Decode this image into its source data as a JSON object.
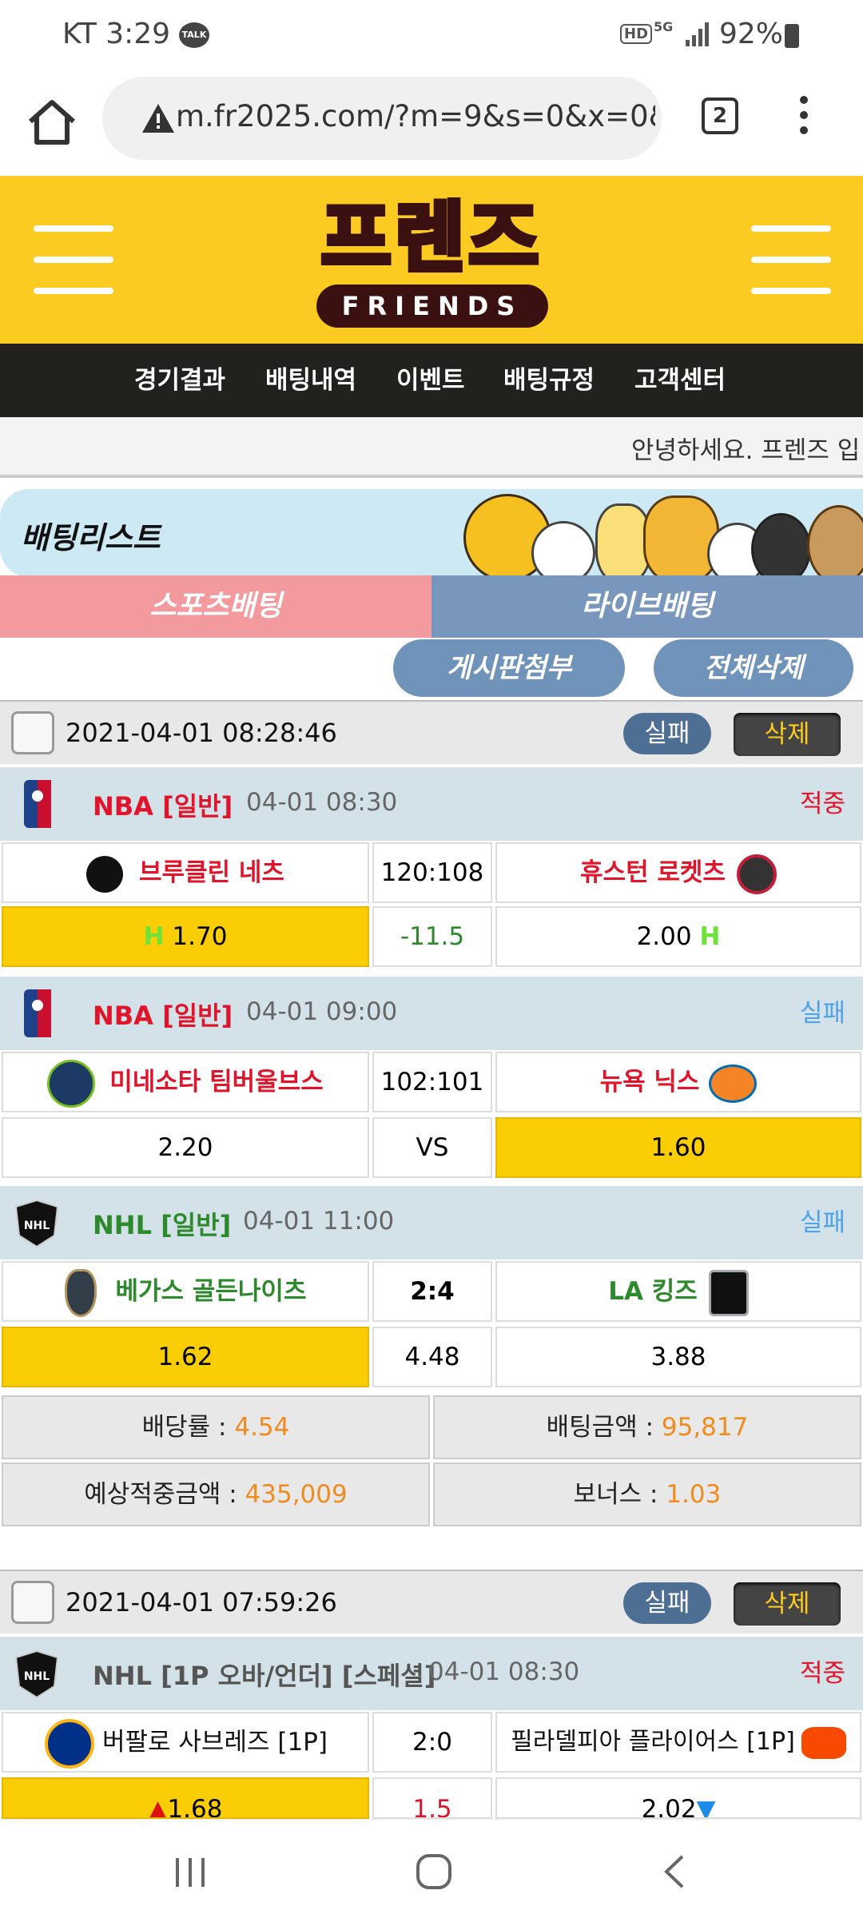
{
  "status_bar": {
    "carrier_time": "KT 3:29",
    "talk": "TALK",
    "hd": "HD",
    "net": "5G",
    "battery": "92%"
  },
  "browser": {
    "url": "m.fr2025.com/?m=9&s=0&x=0&p=",
    "tab_count": "2"
  },
  "logo": {
    "korean": "프렌즈",
    "english": "FRIENDS"
  },
  "nav": [
    "경기결과",
    "배팅내역",
    "이벤트",
    "배팅규정",
    "고객센터"
  ],
  "marquee": "안녕하세요. 프렌즈 입",
  "betlist_title": "배팅리스트",
  "tabs": {
    "sports": "스포츠배팅",
    "live": "라이브배팅"
  },
  "actions": {
    "attach": "게시판첨부",
    "delete_all": "전체삭제"
  },
  "colors": {
    "yellow": "#fbcb22",
    "nav_dark": "#22211d",
    "red_text": "#e0142b",
    "green_text": "#2c8a2c",
    "fail_blue": "#4ea2e8",
    "orange": "#f08b1e"
  },
  "bets": [
    {
      "datetime": "2021-04-01 08:28:46",
      "status_label": "실패",
      "delete_label": "삭제",
      "games": [
        {
          "league": "NBA  [일반]",
          "time": "04-01 08:30",
          "result": "적중",
          "home": "브루클린 네츠",
          "score": "120:108",
          "away": "휴스턴 로켓츠",
          "home_odds": "1.70",
          "mid": "-11.5",
          "away_odds": "2.00",
          "home_mark": "H",
          "away_mark": "H"
        },
        {
          "league": "NBA  [일반]",
          "time": "04-01 09:00",
          "result": "실패",
          "home": "미네소타 팀버울브스",
          "score": "102:101",
          "away": "뉴욕 닉스",
          "home_odds": "2.20",
          "mid": "VS",
          "away_odds": "1.60"
        },
        {
          "league": "NHL  [일반]",
          "time": "04-01 11:00",
          "result": "실패",
          "home": "베가스 골든나이츠",
          "score": "2:4",
          "away": "LA 킹즈",
          "home_odds": "1.62",
          "mid": "4.48",
          "away_odds": "3.88"
        }
      ],
      "summary": {
        "odds_label": "배당률 : ",
        "odds": "4.54",
        "amount_label": "배팅금액 : ",
        "amount": "95,817",
        "expected_label": "예상적중금액 : ",
        "expected": "435,009",
        "bonus_label": "보너스 : ",
        "bonus": "1.03"
      }
    },
    {
      "datetime": "2021-04-01 07:59:26",
      "status_label": "실패",
      "delete_label": "삭제",
      "games": [
        {
          "league": "NHL [1P 오바/언더] [스페셜]",
          "time": "04-01 08:30",
          "result": "적중",
          "home": "버팔로 사브레즈 [1P]",
          "score": "2:0",
          "away": "필라델피아 플라이어스 [1P]",
          "home_odds": "1.68",
          "mid": "1.5",
          "away_odds": "2.02"
        }
      ]
    }
  ]
}
